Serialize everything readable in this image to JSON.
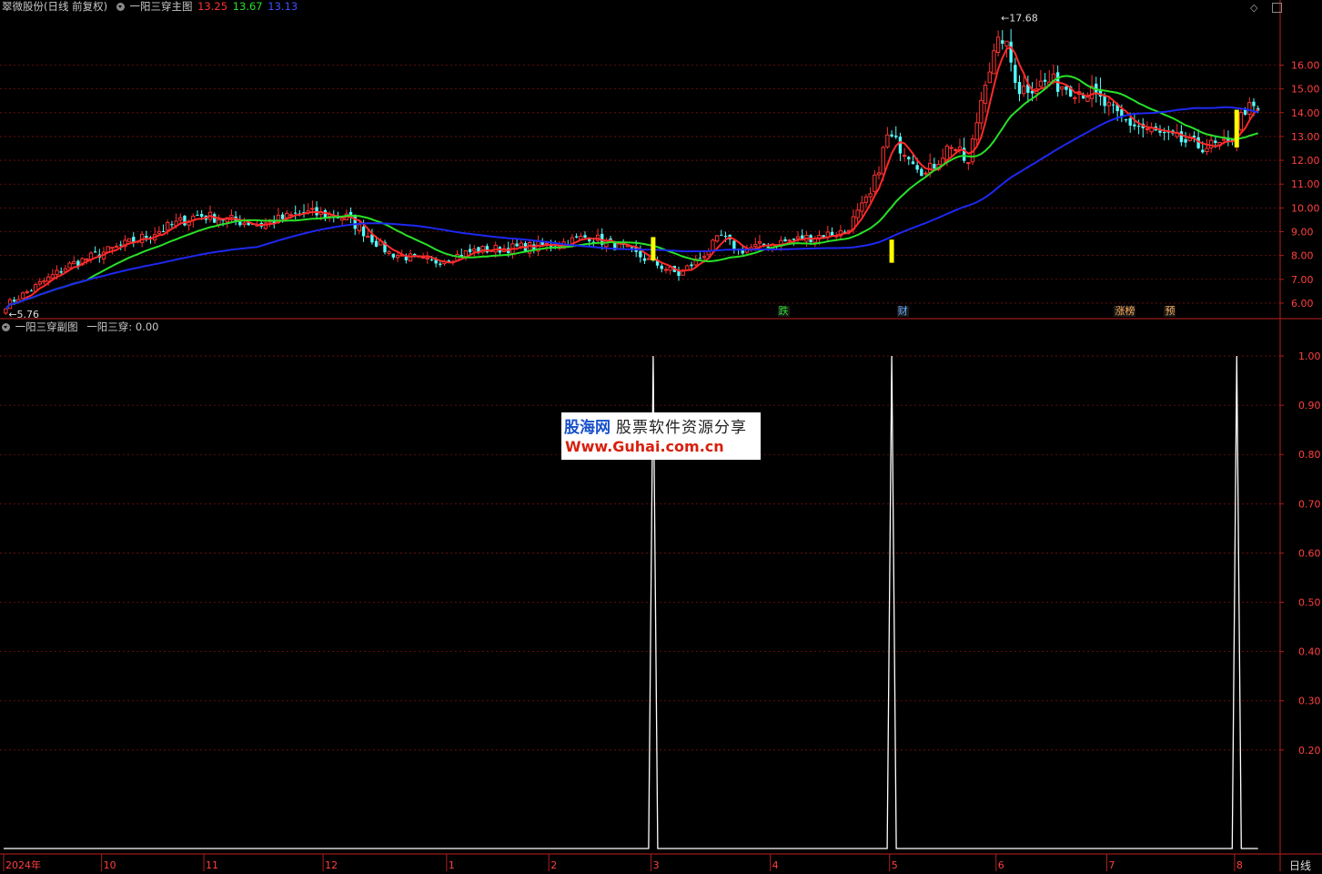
{
  "header_main": {
    "stock": "翠微股份(日线 前复权)",
    "indicator": "一阳三穿主图",
    "v1": "13.25",
    "v2": "13.67",
    "v3": "13.13"
  },
  "header_sub": {
    "indicator": "一阳三穿副图",
    "value_label": "一阳三穿: 0.00"
  },
  "period_label": "日线",
  "colors": {
    "up": "#ff3232",
    "down": "#54fcfc",
    "ma_short": "#ff2a2a",
    "ma_mid": "#28e028",
    "ma_long": "#1e28f0",
    "signal": "#ffff00",
    "grid": "#7a1010",
    "axis_text": "#ff4040",
    "sub_line": "#ffffff"
  },
  "chart_data": [
    {
      "type": "candlestick",
      "title": "一阳三穿主图",
      "ylim": [
        5.5,
        18.2
      ],
      "y_ticks": [
        "6.00",
        "7.00",
        "8.00",
        "9.00",
        "10.00",
        "11.00",
        "12.00",
        "13.00",
        "14.00",
        "15.00",
        "16.00"
      ],
      "y_tick_values": [
        6,
        7,
        8,
        9,
        10,
        11,
        12,
        13,
        14,
        15,
        16
      ],
      "annotations": [
        {
          "text": "17.68",
          "value": 17.68,
          "position": "max"
        },
        {
          "text": "5.76",
          "value": 5.76,
          "position": "min"
        }
      ],
      "signal_labels": [
        {
          "text": "跌",
          "color": "#28e028",
          "month": "4"
        },
        {
          "text": "财",
          "color": "#66aaff",
          "month": "5"
        },
        {
          "text": "涨榜",
          "color": "#ffaa55",
          "month": "7"
        },
        {
          "text": "预",
          "color": "#ffaa55",
          "month": "7"
        }
      ],
      "highlight_bars": [
        {
          "month": "3",
          "value": 8.2
        },
        {
          "month": "5",
          "value": 8.1
        },
        {
          "month": "8",
          "value": 13.2
        }
      ],
      "trend_keypoints": [
        [
          0,
          5.9
        ],
        [
          15,
          7.6
        ],
        [
          30,
          8.6
        ],
        [
          45,
          9.7
        ],
        [
          60,
          9.3
        ],
        [
          70,
          9.8
        ],
        [
          80,
          9.6
        ],
        [
          90,
          8.1
        ],
        [
          100,
          7.7
        ],
        [
          110,
          8.2
        ],
        [
          125,
          8.4
        ],
        [
          130,
          8.5
        ],
        [
          137,
          8.8
        ],
        [
          145,
          8.3
        ],
        [
          152,
          7.7
        ],
        [
          158,
          7.2
        ],
        [
          163,
          7.9
        ],
        [
          168,
          8.8
        ],
        [
          172,
          8.2
        ],
        [
          180,
          8.5
        ],
        [
          190,
          8.8
        ],
        [
          197,
          9.0
        ],
        [
          203,
          10.5
        ],
        [
          207,
          13.0
        ],
        [
          212,
          12.3
        ],
        [
          216,
          11.4
        ],
        [
          222,
          12.7
        ],
        [
          226,
          11.8
        ],
        [
          230,
          15.5
        ],
        [
          234,
          17.2
        ],
        [
          238,
          15.0
        ],
        [
          245,
          15.3
        ],
        [
          255,
          14.8
        ],
        [
          262,
          13.7
        ],
        [
          272,
          13.0
        ],
        [
          280,
          12.6
        ],
        [
          287,
          12.6
        ],
        [
          291,
          14.2
        ],
        [
          294,
          14.0
        ]
      ]
    },
    {
      "type": "line",
      "title": "一阳三穿副图",
      "ylim": [
        0,
        1.05
      ],
      "y_ticks": [
        "0.20",
        "0.30",
        "0.40",
        "0.50",
        "0.60",
        "0.70",
        "0.80",
        "0.90",
        "1.00"
      ],
      "y_tick_values": [
        0.2,
        0.3,
        0.4,
        0.5,
        0.6,
        0.7,
        0.8,
        0.9,
        1.0
      ],
      "series": [
        {
          "values": [
            0,
            1,
            0,
            1,
            0,
            1,
            0
          ]
        }
      ],
      "spike_months": [
        "3",
        "5",
        "8"
      ]
    }
  ],
  "x_axis": {
    "labels": [
      {
        "text": "2024年",
        "bar": 0
      },
      {
        "text": "10",
        "bar": 23
      },
      {
        "text": "11",
        "bar": 47
      },
      {
        "text": "12",
        "bar": 75
      },
      {
        "text": "1",
        "bar": 104
      },
      {
        "text": "2",
        "bar": 128
      },
      {
        "text": "3",
        "bar": 152
      },
      {
        "text": "4",
        "bar": 180
      },
      {
        "text": "5",
        "bar": 208
      },
      {
        "text": "6",
        "bar": 233
      },
      {
        "text": "7",
        "bar": 259
      },
      {
        "text": "8",
        "bar": 289
      }
    ],
    "total_bars": 295
  },
  "watermark": {
    "brand": "股海网",
    "slogan": "股票软件资源分享",
    "url": "Www.Guhai.com.cn"
  }
}
